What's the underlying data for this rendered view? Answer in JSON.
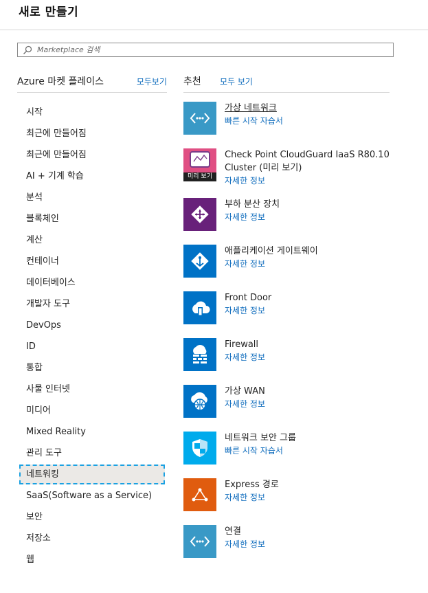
{
  "header": {
    "title": "새로 만들기"
  },
  "search": {
    "placeholder": "Marketplace 검색",
    "value": ""
  },
  "marketplace": {
    "heading": "Azure 마켓 플레이스",
    "see_all": "모두보기",
    "categories": [
      "시작",
      "최근에 만들어짐",
      "최근에 만들어짐",
      "AI + 기계 학습",
      "분석",
      "블록체인",
      "계산",
      "컨테이너",
      "데이터베이스",
      "개발자 도구",
      "DevOps",
      "ID",
      "통합",
      "사물 인터넷",
      "미디어",
      "Mixed Reality",
      "관리 도구",
      "네트워킹",
      "SaaS(Software as a Service)",
      "보안",
      "저장소",
      "웹"
    ],
    "selected_category": "네트워킹"
  },
  "featured": {
    "heading": "추천",
    "see_all": "모두 보기",
    "items": [
      {
        "name": "가상 네트워크",
        "link": "빠른 시작 자습서",
        "icon": "vnet-icon",
        "color": "#3999c6"
      },
      {
        "name": "Check Point CloudGuard IaaS R80.10 Cluster (미리 보기)",
        "badge": "미리 보기",
        "link": "자세한 정보",
        "icon": "checkpoint-logo-icon",
        "color": "#e04f83"
      },
      {
        "name": "부하 분산 장치",
        "link": "자세한 정보",
        "icon": "load-balancer-icon",
        "color": "#68217a"
      },
      {
        "name": "애플리케이션 게이트웨이",
        "link": "자세한 정보",
        "icon": "app-gateway-icon",
        "color": "#0072c6"
      },
      {
        "name": "Front Door",
        "link": "자세한 정보",
        "icon": "front-door-icon",
        "color": "#0072c6"
      },
      {
        "name": "Firewall",
        "link": "자세한 정보",
        "icon": "firewall-icon",
        "color": "#0072c6"
      },
      {
        "name": "가상 WAN",
        "link": "자세한 정보",
        "icon": "virtual-wan-icon",
        "color": "#0072c6"
      },
      {
        "name": "네트워크 보안 그룹",
        "link": "빠른 시작 자습서",
        "icon": "shield-icon",
        "color": "#00abec"
      },
      {
        "name": "Express 경로",
        "link": "자세한 정보",
        "icon": "expressroute-icon",
        "color": "#e05c0f"
      },
      {
        "name": "연결",
        "link": "자세한 정보",
        "icon": "connection-icon",
        "color": "#3999c6"
      }
    ]
  }
}
